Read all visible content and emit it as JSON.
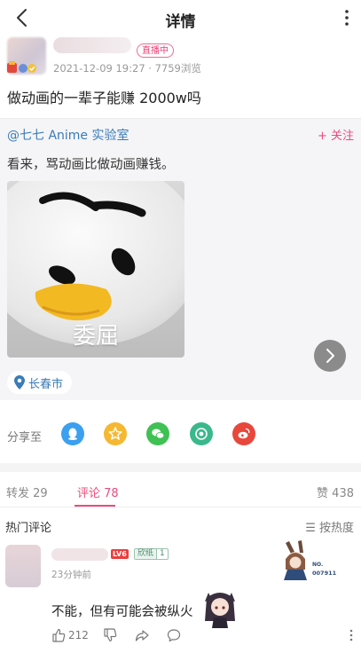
{
  "header": {
    "title": "详情",
    "back_icon": "chevron-left-icon",
    "more_icon": "more-vertical-icon"
  },
  "post": {
    "live_badge": "直播中",
    "date": "2021-12-09 19:27",
    "views": "· 7759浏览",
    "title": "做动画的一辈子能赚 2000w吗"
  },
  "repost": {
    "origin": "@七七 Anime 实验室",
    "follow_label": "+ 关注",
    "text": "看来，骂动画比做动画赚钱。",
    "image_caption": "委屈",
    "location": "长春市"
  },
  "share": {
    "label": "分享至",
    "targets": [
      "qq-icon",
      "qzone-star-icon",
      "wechat-icon",
      "moments-icon",
      "weibo-icon"
    ]
  },
  "tabs": {
    "repost": "转发 29",
    "comments": "评论 78",
    "likes": "赞 438"
  },
  "comments_section": {
    "title": "热门评论",
    "sort_label": "☰ 按热度"
  },
  "comment": {
    "level": "LV6",
    "fan_name": "欣纸",
    "fan_level": "1",
    "time": "23分钟前",
    "text": "不能，但有可能会被纵火",
    "likes": "212",
    "badge_no": "NO.",
    "badge_id": "007911"
  },
  "colors": {
    "accent": "#ee4a7d",
    "link": "#3a7bb8",
    "card_bg": "#f5f5f7"
  }
}
